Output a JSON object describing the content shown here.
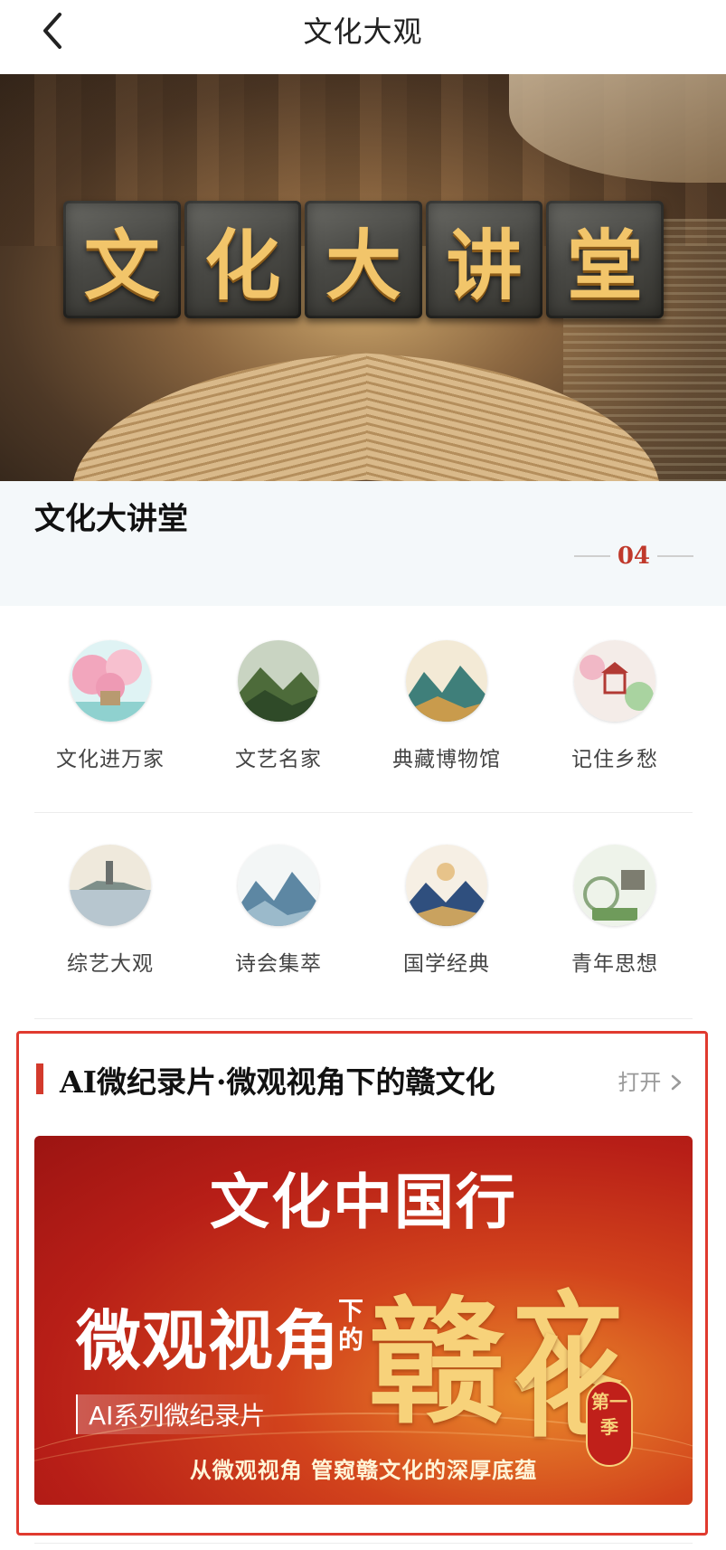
{
  "header": {
    "title": "文化大观",
    "back_icon": "chevron-left-icon"
  },
  "hero": {
    "banner_chars": [
      "文",
      "化",
      "大",
      "讲",
      "堂"
    ],
    "colors": {
      "stone": "#4a4a46",
      "gold": "#f2c56a"
    }
  },
  "lecture": {
    "title": "文化大讲堂",
    "page_number": "04"
  },
  "categories": [
    {
      "label": "文化进万家",
      "icon": "cherry-blossom-house-icon"
    },
    {
      "label": "文艺名家",
      "icon": "green-mountains-icon"
    },
    {
      "label": "典藏博物馆",
      "icon": "landscape-painting-icon"
    },
    {
      "label": "记住乡愁",
      "icon": "pavilion-icon"
    },
    {
      "label": "综艺大观",
      "icon": "pagoda-lake-icon"
    },
    {
      "label": "诗会集萃",
      "icon": "ink-mountains-icon"
    },
    {
      "label": "国学经典",
      "icon": "sun-mountains-icon"
    },
    {
      "label": "青年思想",
      "icon": "garden-window-icon"
    }
  ],
  "ai_section": {
    "title": "AI微纪录片·微观视角下的赣文化",
    "open_label": "打开",
    "accent_color": "#d33a2c",
    "poster": {
      "top_title": "文化中国行",
      "main_text": "微观视角",
      "small_text": "下的",
      "gan": "赣",
      "wen": "文",
      "hua": "化",
      "season": "第一季",
      "subtitle": "AI系列微纪录片",
      "footer": "从微观视角 管窥赣文化的深厚底蕴"
    }
  }
}
